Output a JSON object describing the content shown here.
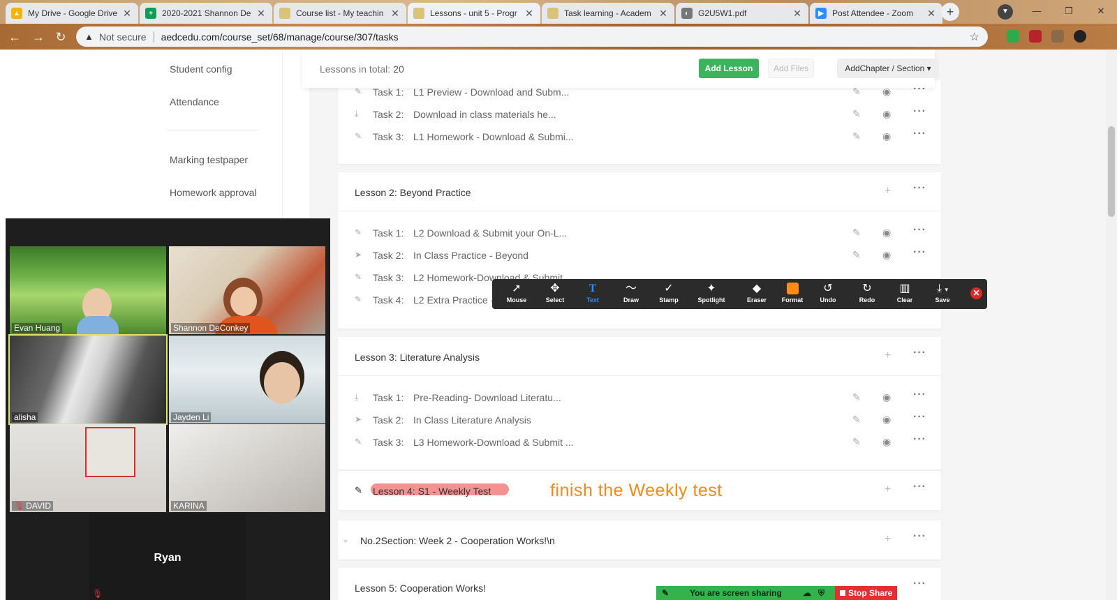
{
  "browser": {
    "tabs": [
      {
        "title": "My Drive - Google Drive",
        "favicon_color": "#f4b400",
        "favicon_glyph": "▲",
        "active": false
      },
      {
        "title": "2020-2021 Shannon De",
        "favicon_color": "#0f9d58",
        "favicon_glyph": "+",
        "active": false
      },
      {
        "title": "Course list - My teachin",
        "favicon_color": "#d9c27a",
        "favicon_glyph": "",
        "active": false
      },
      {
        "title": "Lessons - unit 5 - Progr",
        "favicon_color": "#d9c27a",
        "favicon_glyph": "",
        "active": true
      },
      {
        "title": "Task learning - Academ",
        "favicon_color": "#d9c27a",
        "favicon_glyph": "",
        "active": false
      },
      {
        "title": "G2U5W1.pdf",
        "favicon_color": "#777777",
        "favicon_glyph": "◐",
        "active": false
      },
      {
        "title": "Post Attendee - Zoom",
        "favicon_color": "#2d8cff",
        "favicon_glyph": "▶",
        "active": false
      }
    ],
    "not_secure": "Not secure",
    "url": "aedcedu.com/course_set/68/manage/course/307/tasks"
  },
  "sidebar": {
    "items": [
      {
        "label": "Student config"
      },
      {
        "label": "Attendance"
      },
      {
        "label": "Marking testpaper"
      },
      {
        "label": "Homework approval"
      }
    ]
  },
  "summary": {
    "label": "Lessons in total:",
    "count": "20",
    "add_lesson": "Add Lesson",
    "add_files": "Add Files",
    "add_chapter": "AddChapter / Section ▾"
  },
  "lessons": [
    {
      "tasks": [
        {
          "label": "Task 1:",
          "name": "L1 Preview - Download and Subm...",
          "icon": "pencil"
        },
        {
          "label": "Task 2:",
          "name": "Download in class materials he...",
          "icon": "download"
        },
        {
          "label": "Task 3:",
          "name": "L1 Homework - Download & Submi...",
          "icon": "pencil"
        }
      ]
    },
    {
      "title": "Lesson 2:   Beyond Practice",
      "tasks": [
        {
          "label": "Task 1:",
          "name": "L2 Download & Submit your On-L...",
          "icon": "pencil"
        },
        {
          "label": "Task 2:",
          "name": "In Class Practice - Beyond",
          "icon": "send"
        },
        {
          "label": "Task 3:",
          "name": "L2 Homework-Download & Submit...",
          "icon": "pencil"
        },
        {
          "label": "Task 4:",
          "name": "L2 Extra Practice -",
          "icon": "pencil"
        }
      ]
    },
    {
      "title": "Lesson 3:   Literature Analysis",
      "tasks": [
        {
          "label": "Task 1:",
          "name": "Pre-Reading- Download Literatu...",
          "icon": "download"
        },
        {
          "label": "Task 2:",
          "name": "In Class Literature Analysis",
          "icon": "send"
        },
        {
          "label": "Task 3:",
          "name": "L3 Homework-Download & Submit ...",
          "icon": "pencil"
        }
      ]
    },
    {
      "title": "Lesson 4:   S1 - Weekly Test"
    },
    {
      "title": "No.2Section:  Week 2 - Cooperation Works!\\n"
    },
    {
      "title": "Lesson 5:   Cooperation Works!"
    }
  ],
  "annotation_text": "finish the Weekly test",
  "zoom_toolbar": {
    "tools": [
      {
        "label": "Mouse",
        "icon": "mouse-pointer-icon",
        "glyph": "➚"
      },
      {
        "label": "Select",
        "icon": "move-arrows-icon",
        "glyph": "✥"
      },
      {
        "label": "Text",
        "icon": "text-icon",
        "glyph": "T",
        "active": true
      },
      {
        "label": "Draw",
        "icon": "squiggle-icon",
        "glyph": "〜"
      },
      {
        "label": "Stamp",
        "icon": "checkmark-icon",
        "glyph": "✓"
      },
      {
        "label": "Spotlight",
        "icon": "spotlight-wand-icon",
        "glyph": "✨"
      },
      {
        "label": "Eraser",
        "icon": "eraser-icon",
        "glyph": "◆"
      },
      {
        "label": "Format",
        "icon": "format-swatch-icon",
        "glyph": "■"
      },
      {
        "label": "Undo",
        "icon": "undo-icon",
        "glyph": "↺"
      },
      {
        "label": "Redo",
        "icon": "redo-icon",
        "glyph": "↻"
      },
      {
        "label": "Clear",
        "icon": "trash-icon",
        "glyph": "🗑"
      },
      {
        "label": "Save",
        "icon": "save-download-icon",
        "glyph": "⤓"
      }
    ],
    "format_color": "#ff8c1a",
    "active_color": "#2d8cff"
  },
  "gallery": {
    "participants": [
      {
        "name": "Evan Huang"
      },
      {
        "name": "Shannon DeConkey"
      },
      {
        "name": "alisha"
      },
      {
        "name": "Jayden Li"
      },
      {
        "name": "DAVID",
        "muted": true
      },
      {
        "name": "KARINA"
      },
      {
        "name": "Ryan",
        "muted": true
      }
    ]
  },
  "share_bar": {
    "status": "You are screen sharing",
    "stop": "Stop Share"
  },
  "colors": {
    "green_button": "#3cb35d",
    "annotation": "#f08a1c",
    "highlight": "#f06e6e",
    "stop_share": "#e62e2e"
  }
}
